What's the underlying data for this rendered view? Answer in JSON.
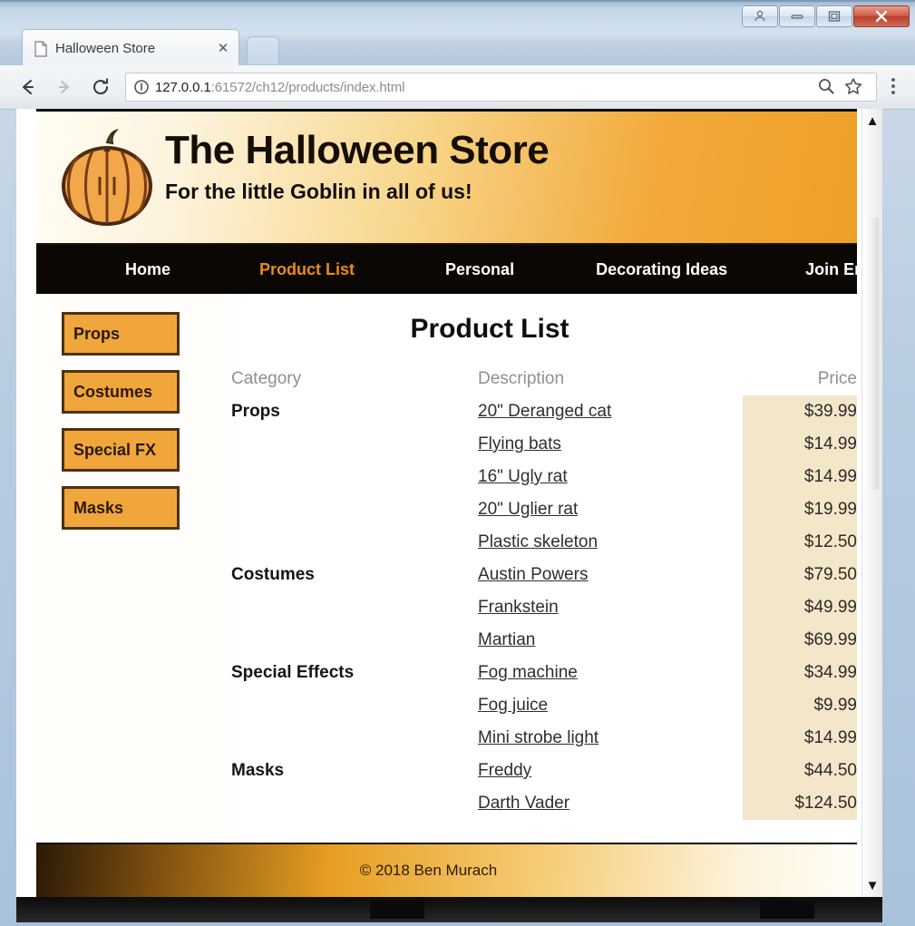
{
  "browser": {
    "tab": {
      "title": "Halloween Store",
      "favicon_icon": "page-icon",
      "close_icon": "close-icon"
    },
    "new_tab_icon": "new-tab-icon",
    "nav": {
      "back_icon": "back-arrow-icon",
      "forward_icon": "forward-arrow-icon",
      "reload_icon": "reload-icon"
    },
    "omnibox": {
      "security_icon": "info-circle-icon",
      "host": "127.0.0.1",
      "path": ":61572/ch12/products/index.html",
      "url": "127.0.0.1:61572/ch12/products/index.html"
    },
    "toolbar_icons": {
      "zoom": "search-icon",
      "bookmark": "star-icon",
      "menu": "three-dot-menu-icon"
    },
    "window_controls": {
      "user_icon": "user-account-icon",
      "minimize_icon": "minimize-icon",
      "maximize_icon": "maximize-icon",
      "close_icon": "window-close-icon"
    },
    "scrollbar": {
      "up_arrow_icon": "scroll-up-arrow-icon",
      "down_arrow_icon": "scroll-down-arrow-icon"
    }
  },
  "site": {
    "banner": {
      "logo_icon": "pumpkin-icon",
      "heading": "The Halloween Store",
      "tagline": "For the little Goblin in all of us!"
    },
    "nav": [
      {
        "label": "Home",
        "active": false
      },
      {
        "label": "Product List",
        "active": true
      },
      {
        "label": "Personal",
        "active": false
      },
      {
        "label": "Decorating Ideas",
        "active": false
      },
      {
        "label": "Join Email",
        "active": false
      }
    ],
    "sidebar": [
      {
        "label": "Props"
      },
      {
        "label": "Costumes"
      },
      {
        "label": "Special FX"
      },
      {
        "label": "Masks"
      }
    ],
    "main": {
      "title": "Product List",
      "table": {
        "headers": [
          "Category",
          "Description",
          "Price"
        ],
        "rows": [
          {
            "category": "Props",
            "description": "20\" Deranged cat",
            "price": "$39.99"
          },
          {
            "category": "",
            "description": "Flying bats",
            "price": "$14.99"
          },
          {
            "category": "",
            "description": "16\" Ugly rat",
            "price": "$14.99"
          },
          {
            "category": "",
            "description": "20\" Uglier rat",
            "price": "$19.99"
          },
          {
            "category": "",
            "description": "Plastic skeleton",
            "price": "$12.50"
          },
          {
            "category": "Costumes",
            "description": "Austin Powers",
            "price": "$79.50"
          },
          {
            "category": "",
            "description": "Frankstein",
            "price": "$49.99"
          },
          {
            "category": "",
            "description": "Martian",
            "price": "$69.99"
          },
          {
            "category": "Special Effects",
            "description": "Fog machine",
            "price": "$34.99"
          },
          {
            "category": "",
            "description": "Fog juice",
            "price": "$9.99"
          },
          {
            "category": "",
            "description": "Mini strobe light",
            "price": "$14.99"
          },
          {
            "category": "Masks",
            "description": "Freddy",
            "price": "$44.50"
          },
          {
            "category": "",
            "description": "Darth Vader",
            "price": "$124.50"
          }
        ]
      }
    },
    "footer": {
      "copyright": "© 2018 Ben Murach"
    },
    "colors": {
      "accent_orange": "#f0a63a",
      "nav_active": "#e98c16",
      "nav_background": "#0a0705",
      "price_background": "#f4e6c8",
      "button_border": "#4f3114"
    }
  }
}
